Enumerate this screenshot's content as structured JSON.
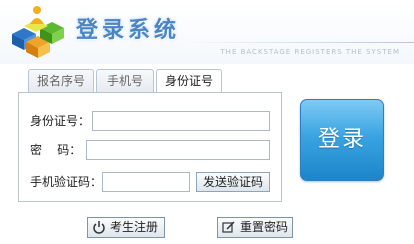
{
  "header": {
    "title": "登录系统",
    "subtitle": "THE BACKSTAGE REGISTERS THE SYSTEM",
    "logo_icon": "colored-cubes-logo"
  },
  "tabs": [
    {
      "label": "报名序号",
      "active": false
    },
    {
      "label": "手机号",
      "active": false
    },
    {
      "label": "身份证号",
      "active": true
    }
  ],
  "form": {
    "id_label": "身份证号：",
    "id_value": "",
    "password_label": "密    码：",
    "password_value": "",
    "sms_label": "手机验证码：",
    "sms_value": "",
    "send_code_label": "发送验证码"
  },
  "login_button": "登录",
  "bottom": {
    "register_label": "考生注册",
    "register_icon": "power-icon",
    "reset_label": "重置密码",
    "reset_icon": "edit-icon"
  },
  "colors": {
    "title": "#4a86c5",
    "login_button": "#3aa4e2",
    "border": "#b9c6d2"
  }
}
